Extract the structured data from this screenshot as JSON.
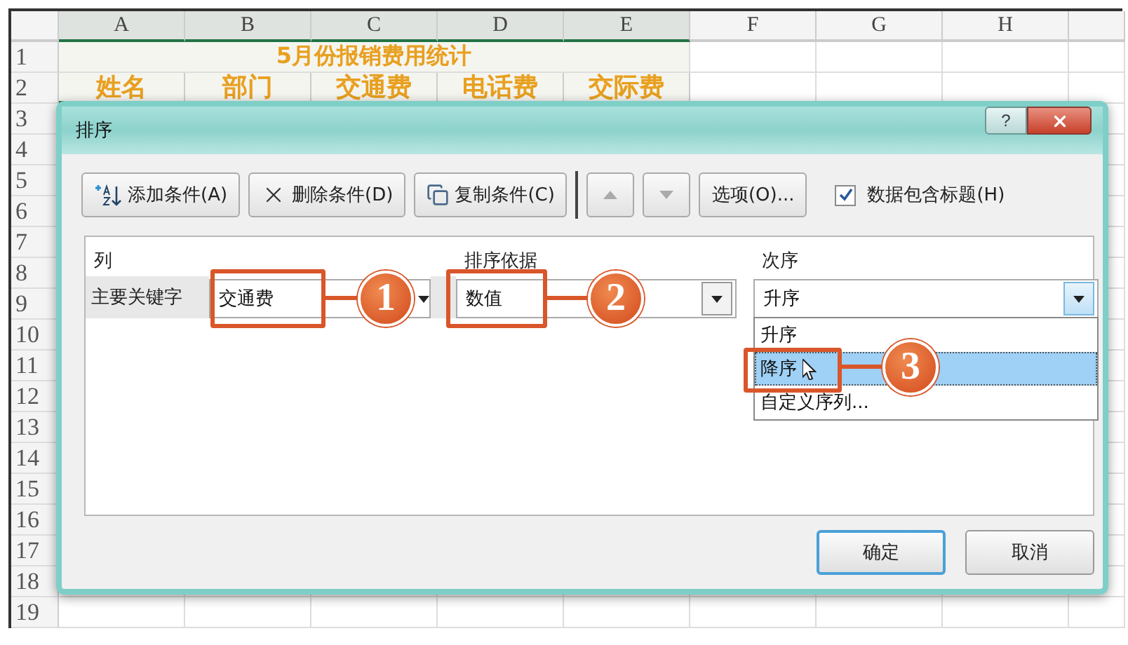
{
  "sheet": {
    "columns": [
      "A",
      "B",
      "C",
      "D",
      "E",
      "F",
      "G",
      "H"
    ],
    "rows": [
      "1",
      "2",
      "3",
      "4",
      "5",
      "6",
      "7",
      "8",
      "9",
      "10",
      "11",
      "12",
      "13",
      "14",
      "15",
      "16",
      "17",
      "18",
      "19"
    ],
    "title": "5月份报销费用统计",
    "headers": [
      "姓名",
      "部门",
      "交通费",
      "电话费",
      "交际费"
    ]
  },
  "dialog": {
    "title": "排序",
    "help": "?",
    "toolbar": [
      {
        "kind": "add",
        "label": "添加条件(A)",
        "disabled": false
      },
      {
        "kind": "delete",
        "label": "删除条件(D)",
        "disabled": false
      },
      {
        "kind": "copy",
        "label": "复制条件(C)",
        "disabled": false
      },
      {
        "kind": "up",
        "disabled": true
      },
      {
        "kind": "down",
        "disabled": true
      },
      {
        "kind": "options",
        "label": "选项(O)...",
        "disabled": false
      }
    ],
    "has_headers": {
      "label": "数据包含标题(H)",
      "checked": true
    },
    "columns": [
      "列",
      "排序依据",
      "次序"
    ],
    "row": {
      "label": "主要关键字",
      "column": "交通费",
      "sort_on": "数值",
      "order": "升序"
    },
    "order_options": [
      {
        "label": "升序",
        "selected": false
      },
      {
        "label": "降序",
        "selected": true
      },
      {
        "label": "自定义序列...",
        "selected": false
      }
    ],
    "buttons": [
      {
        "label": "确定",
        "default": true
      },
      {
        "label": "取消",
        "default": false
      }
    ]
  },
  "callouts": [
    "1",
    "2",
    "3"
  ]
}
